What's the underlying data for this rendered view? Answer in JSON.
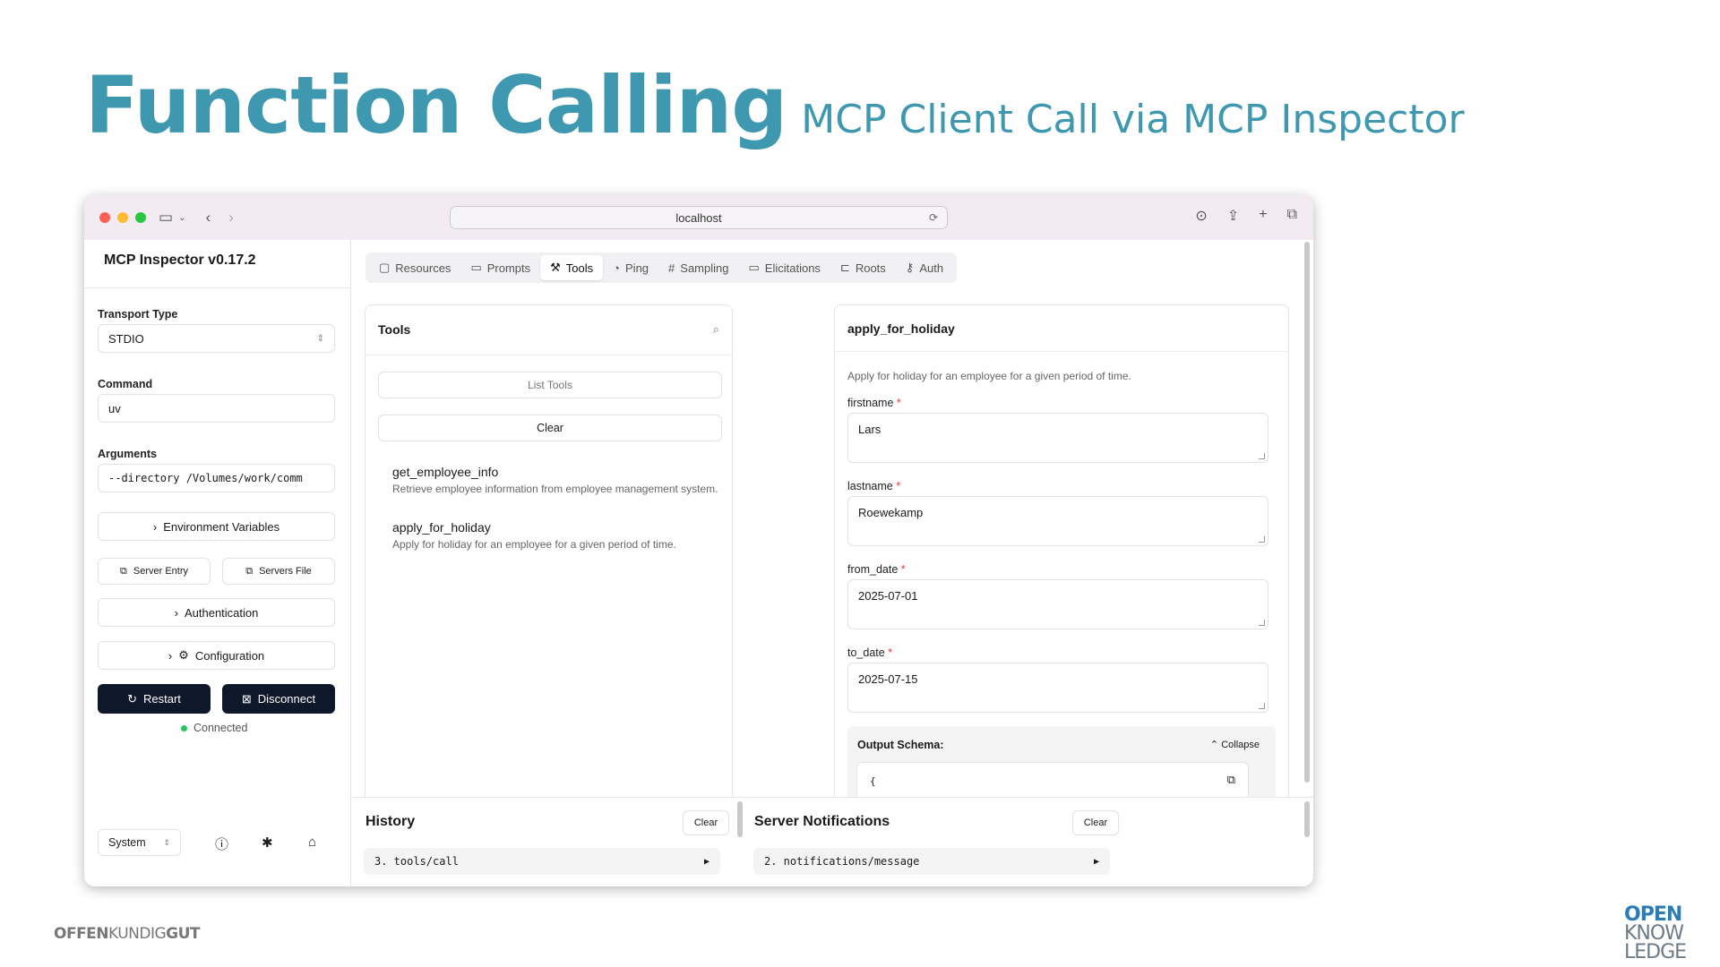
{
  "slide": {
    "title": "Function Calling",
    "subtitle": "MCP Client Call via MCP Inspector"
  },
  "browser": {
    "url": "localhost"
  },
  "sidebar": {
    "app_title": "MCP Inspector v0.17.2",
    "transport_label": "Transport Type",
    "transport_value": "STDIO",
    "command_label": "Command",
    "command_value": "uv",
    "arguments_label": "Arguments",
    "arguments_value": "--directory /Volumes/work/comm",
    "env_vars": "Environment Variables",
    "server_entry": "Server Entry",
    "servers_file": "Servers File",
    "authentication": "Authentication",
    "configuration": "Configuration",
    "restart": "Restart",
    "disconnect": "Disconnect",
    "status": "Connected",
    "theme": "System"
  },
  "tabs": [
    "Resources",
    "Prompts",
    "Tools",
    "Ping",
    "Sampling",
    "Elicitations",
    "Roots",
    "Auth"
  ],
  "tools_panel": {
    "title": "Tools",
    "list_tools": "List Tools",
    "clear": "Clear",
    "items": [
      {
        "name": "get_employee_info",
        "desc": "Retrieve employee information from employee management system."
      },
      {
        "name": "apply_for_holiday",
        "desc": "Apply for holiday for an employee for a given period of time."
      }
    ]
  },
  "detail": {
    "title": "apply_for_holiday",
    "desc": "Apply for holiday for an employee for a given period of time.",
    "fields": [
      {
        "label": "firstname",
        "value": "Lars"
      },
      {
        "label": "lastname",
        "value": "Roewekamp"
      },
      {
        "label": "from_date",
        "value": "2025-07-01"
      },
      {
        "label": "to_date",
        "value": "2025-07-15"
      }
    ],
    "output_schema": "Output Schema:",
    "collapse": "Collapse",
    "schema_open": "{"
  },
  "history": {
    "title": "History",
    "clear": "Clear",
    "item": "3. tools/call"
  },
  "notifications": {
    "title": "Server Notifications",
    "clear": "Clear",
    "item": "2. notifications/message"
  },
  "footer": {
    "left_a": "OFFEN",
    "left_b": "KUNDIG",
    "left_c": "GUT",
    "logo_1": "OPEN",
    "logo_2": "KNOW",
    "logo_3": "LEDGE"
  }
}
